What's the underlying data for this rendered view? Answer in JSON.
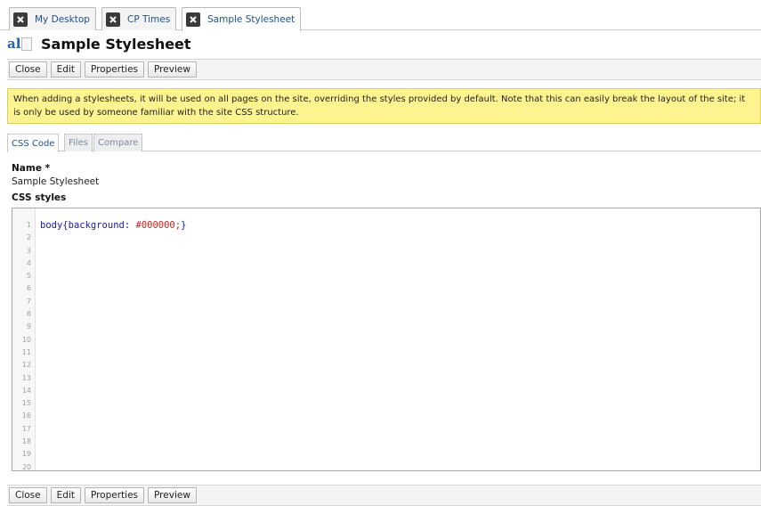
{
  "doc_tabs": [
    {
      "label": "My Desktop",
      "active": false
    },
    {
      "label": "CP Times",
      "active": false
    },
    {
      "label": "Sample Stylesheet",
      "active": true
    }
  ],
  "page": {
    "title": "Sample Stylesheet",
    "logo_text": "al"
  },
  "toolbar": {
    "close_label": "Close",
    "edit_label": "Edit",
    "properties_label": "Properties",
    "preview_label": "Preview"
  },
  "notice": {
    "text": "When adding a stylesheets, it will be used on all pages on the site, overriding the styles provided by default. Note that this can easily break the layout of the site; it is only be used by someone familiar with the site CSS structure."
  },
  "sub_tabs": [
    {
      "label": "CSS Code",
      "active": true
    },
    {
      "label": "Files",
      "active": false
    },
    {
      "label": "Compare",
      "active": false
    }
  ],
  "form": {
    "name_label": "Name *",
    "name_value": "Sample Stylesheet",
    "css_label": "CSS styles"
  },
  "editor": {
    "line_numbers": [
      "1",
      "2",
      "3",
      "4",
      "5",
      "6",
      "7",
      "8",
      "9",
      "10",
      "11",
      "12",
      "13",
      "14",
      "15",
      "16",
      "17",
      "18",
      "19",
      "20"
    ],
    "code_line_1": {
      "selector": "body",
      "open_brace": "{",
      "property": "background:",
      "value": "#000000;",
      "close_brace": "}"
    }
  },
  "colors": {
    "notice_bg": "#fdf48f",
    "link_blue": "#1f4f8f",
    "code_value_red": "#d12020"
  },
  "icons": {
    "tab_close": "close-x-icon",
    "logo": "app-logo-icon",
    "document": "document-icon"
  }
}
